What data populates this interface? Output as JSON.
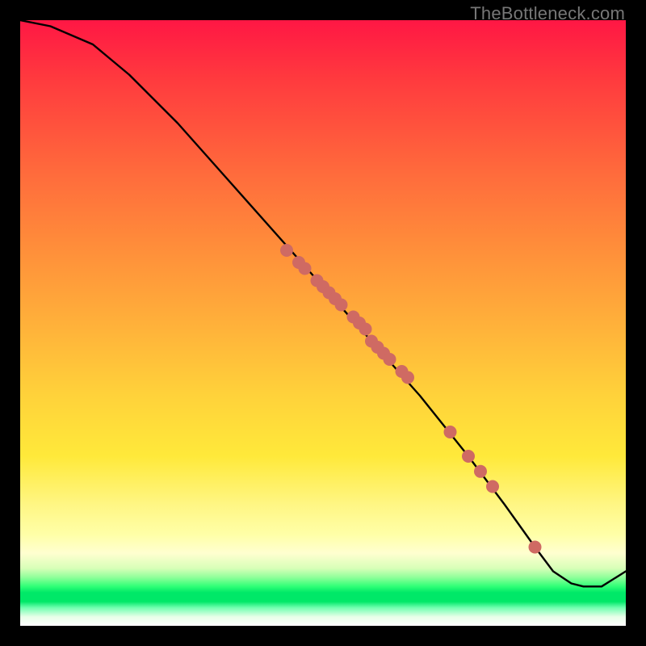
{
  "watermark": "TheBottleneck.com",
  "colors": {
    "curve_stroke": "#000000",
    "marker_fill": "#cf6a63",
    "marker_stroke": "#b85650"
  },
  "chart_data": {
    "type": "line",
    "title": "",
    "xlabel": "",
    "ylabel": "",
    "xlim": [
      0,
      100
    ],
    "ylim": [
      0,
      100
    ],
    "notes": "No numeric axis ticks or labels are rendered; values below are estimated fractional coordinates in [0,100] × [0,100] with origin at bottom-left of the gradient plot area.",
    "series": [
      {
        "name": "bottleneck-curve",
        "x": [
          0,
          5,
          12,
          18,
          26,
          34,
          42,
          50,
          58,
          66,
          74,
          80,
          85,
          88,
          91,
          93,
          96,
          100
        ],
        "y": [
          100,
          99,
          96,
          91,
          83,
          74,
          65,
          56,
          47,
          38,
          28,
          20,
          13,
          9,
          7,
          6.5,
          6.5,
          9
        ]
      }
    ],
    "markers": {
      "name": "highlighted-points",
      "x": [
        44,
        46,
        47,
        49,
        50,
        51,
        52,
        53,
        55,
        56,
        57,
        58,
        59,
        60,
        61,
        63,
        64,
        71,
        74,
        76,
        78,
        85
      ],
      "y": [
        62,
        60,
        59,
        57,
        56,
        55,
        54,
        53,
        51,
        50,
        49,
        47,
        46,
        45,
        44,
        42,
        41,
        32,
        28,
        25.5,
        23,
        13
      ]
    }
  }
}
